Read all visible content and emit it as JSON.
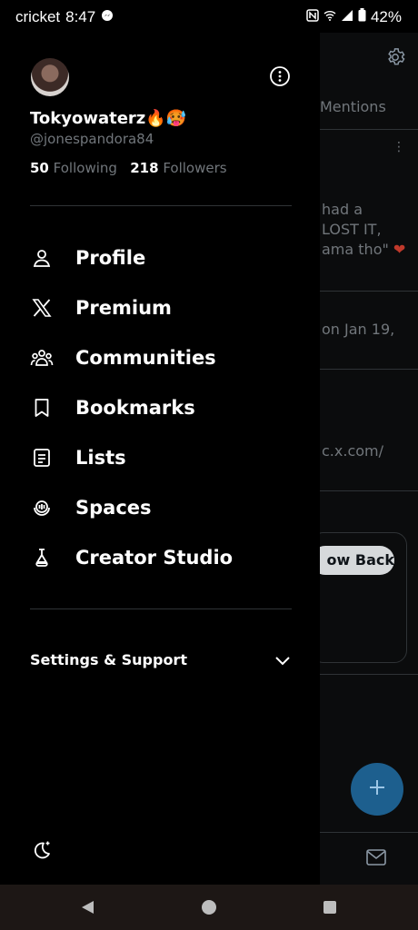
{
  "status_bar": {
    "carrier": "cricket",
    "time": "8:47",
    "battery": "42%"
  },
  "profile": {
    "username": "Tokyowaterz🔥🥵",
    "handle": "@jonespandora84",
    "following_count": "50",
    "following_label": "Following",
    "followers_count": "218",
    "followers_label": "Followers"
  },
  "menu": {
    "items": [
      {
        "label": "Profile",
        "icon": "person-icon"
      },
      {
        "label": "Premium",
        "icon": "x-logo-icon"
      },
      {
        "label": "Communities",
        "icon": "communities-icon"
      },
      {
        "label": "Bookmarks",
        "icon": "bookmark-icon"
      },
      {
        "label": "Lists",
        "icon": "list-icon"
      },
      {
        "label": "Spaces",
        "icon": "spaces-icon"
      },
      {
        "label": "Creator Studio",
        "icon": "creator-studio-icon"
      }
    ]
  },
  "settings": {
    "label": "Settings & Support"
  },
  "background": {
    "tab_label": "Mentions",
    "snippet_1": [
      "had a",
      "LOST IT,",
      "ama tho\""
    ],
    "snippet_2": "on Jan 19,",
    "snippet_3": "c.x.com/",
    "follow_back_label": "ow Back"
  },
  "colors": {
    "accent": "#1d9bf0",
    "fab": "#1d5f8e",
    "heart": "#c0392b"
  }
}
